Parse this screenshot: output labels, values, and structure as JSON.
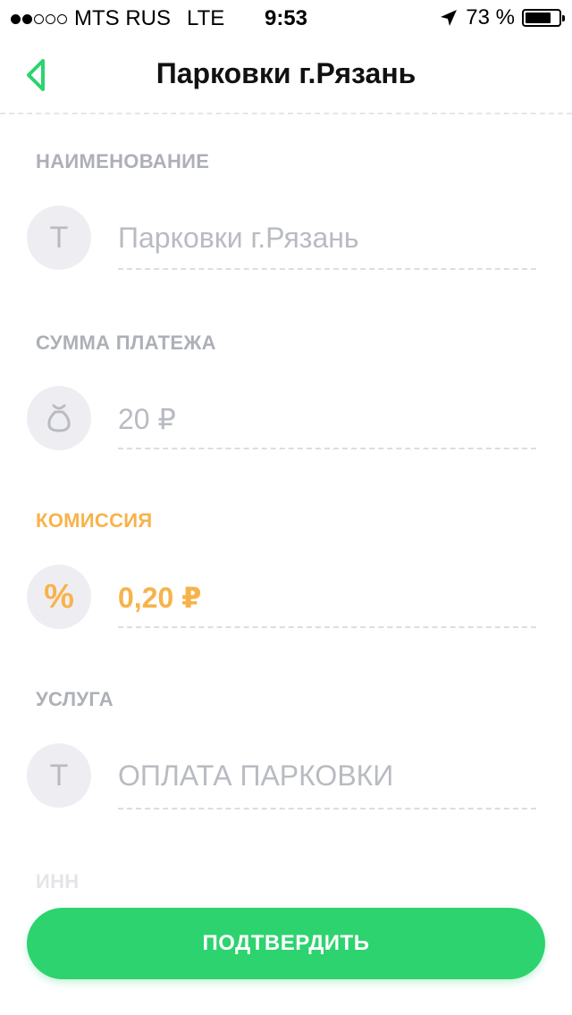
{
  "status_bar": {
    "carrier": "MTS RUS",
    "network": "LTE",
    "time": "9:53",
    "battery": "73 %",
    "signal_bars_filled": 2,
    "signal_bars_total": 5
  },
  "nav": {
    "title": "Парковки г.Рязань",
    "back_icon": "back-chevron-icon"
  },
  "fields": {
    "name": {
      "label": "НАИМЕНОВАНИЕ",
      "value": "Парковки г.Рязань",
      "icon": "text-t-icon"
    },
    "amount": {
      "label": "СУММА ПЛАТЕЖА",
      "value": "20 ₽",
      "icon": "money-bag-icon"
    },
    "commission": {
      "label": "КОМИССИЯ",
      "value": "0,20 ₽",
      "icon": "percent-icon"
    },
    "service": {
      "label": "УСЛУГА",
      "value": "ОПЛАТА ПАРКОВКИ",
      "icon": "text-t-icon"
    },
    "inn": {
      "label": "ИНН"
    }
  },
  "confirm_button": {
    "label": "ПОДТВЕРДИТЬ"
  },
  "colors": {
    "accent_green": "#2dd36e",
    "commission_orange": "#f7b34b",
    "muted_text": "#b9bbc2",
    "label_gray": "#aeb0b8",
    "icon_bg": "#eeeef2"
  }
}
